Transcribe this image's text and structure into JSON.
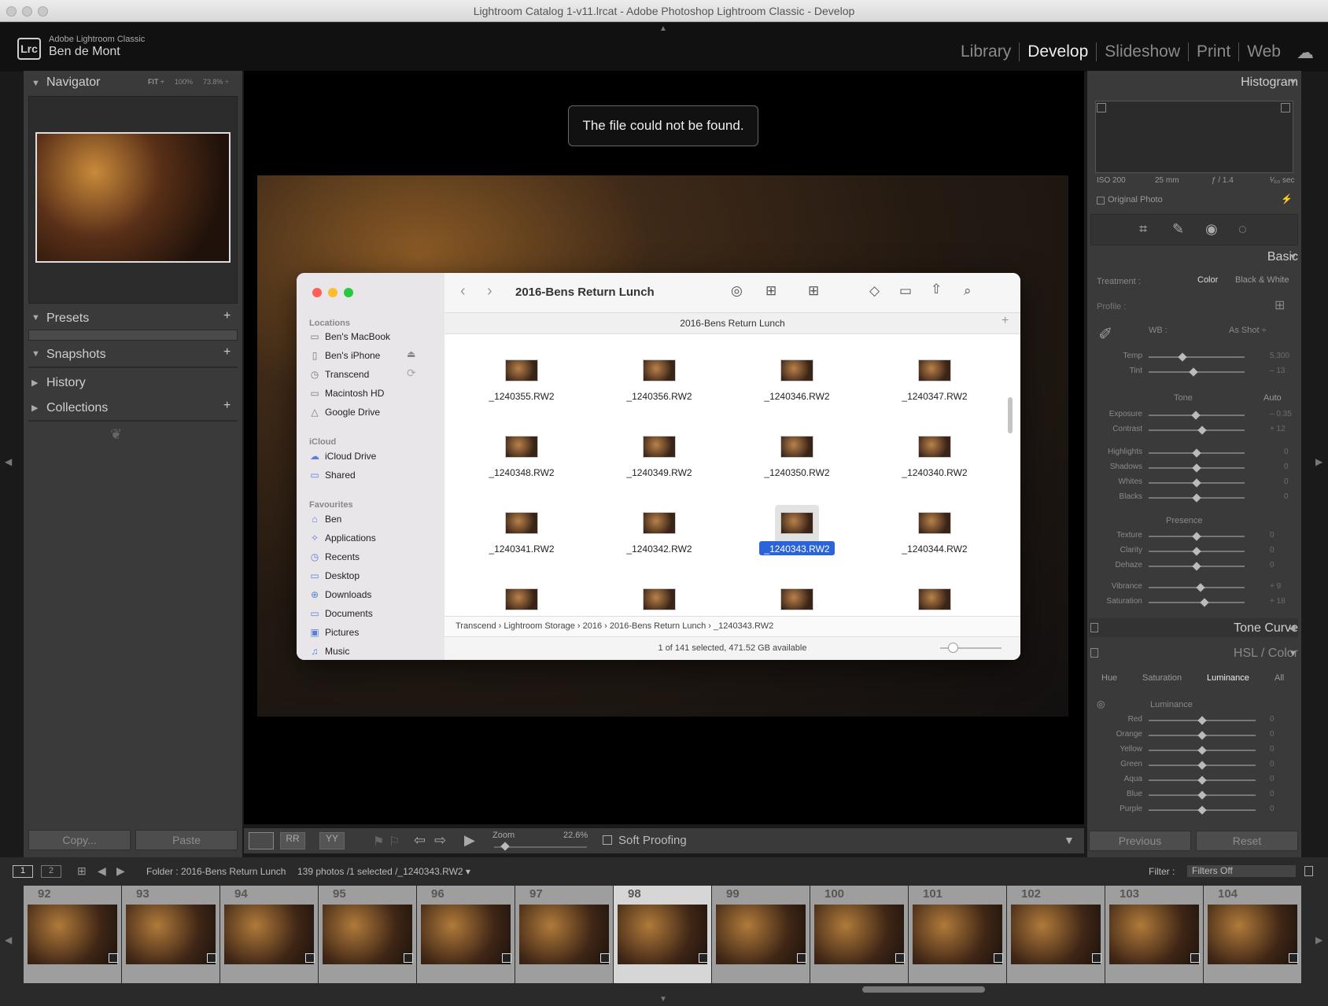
{
  "window": {
    "title": "Lightroom Catalog 1-v11.lrcat - Adobe Photoshop Lightroom Classic - Develop"
  },
  "identity": {
    "product": "Adobe Lightroom Classic",
    "user": "Ben de Mont",
    "logo": "Lrc"
  },
  "modules": [
    "Library",
    "Develop",
    "Slideshow",
    "Print",
    "Web"
  ],
  "navigator": {
    "title": "Navigator",
    "fit": "FIT ÷",
    "z100": "100%",
    "z738": "73.8% ÷"
  },
  "left_panels": {
    "presets": "Presets",
    "snapshots": "Snapshots",
    "history": "History",
    "collections": "Collections"
  },
  "left_buttons": {
    "copy": "Copy...",
    "paste": "Paste"
  },
  "toast": "The file could not be found.",
  "finder": {
    "title": "2016-Bens Return Lunch",
    "path_title": "2016-Bens Return Lunch",
    "sidebar": {
      "locations_label": "Locations",
      "locations": [
        "Ben's MacBook",
        "Ben's iPhone",
        "Transcend",
        "Macintosh HD",
        "Google Drive"
      ],
      "icloud_label": "iCloud",
      "icloud": [
        "iCloud Drive",
        "Shared"
      ],
      "favourites_label": "Favourites",
      "favourites": [
        "Ben",
        "Applications",
        "Recents",
        "Desktop",
        "Downloads",
        "Documents",
        "Pictures",
        "Music"
      ]
    },
    "files": [
      "_1240355.RW2",
      "_1240356.RW2",
      "_1240346.RW2",
      "_1240347.RW2",
      "_1240348.RW2",
      "_1240349.RW2",
      "_1240350.RW2",
      "_1240340.RW2",
      "_1240341.RW2",
      "_1240342.RW2",
      "_1240343.RW2",
      "_1240344.RW2"
    ],
    "selected_file": "_1240343.RW2",
    "breadcrumb": [
      "Transcend",
      "Lightroom Storage",
      "2016",
      "2016-Bens Return Lunch",
      "_1240343.RW2"
    ],
    "status": "1 of 141 selected, 471.52 GB available"
  },
  "center_toolbar": {
    "zoom_label": "Zoom",
    "zoom_value": "22.6%",
    "soft_proofing": "Soft Proofing"
  },
  "right": {
    "histogram": "Histogram",
    "exif": [
      "ISO 200",
      "25 mm",
      "ƒ / 1.4",
      "¹⁄₆₀ sec"
    ],
    "original_photo": "Original Photo",
    "basic": "Basic",
    "treatment_label": "Treatment :",
    "color": "Color",
    "bw": "Black & White",
    "profile_label": "Profile :",
    "wb_label": "WB :",
    "wb_value": "As Shot ÷",
    "wb_sliders": [
      {
        "label": "Temp",
        "value": "5,300",
        "pos": 0.35
      },
      {
        "label": "Tint",
        "value": "– 13",
        "pos": 0.47
      }
    ],
    "tone_label": "Tone",
    "auto": "Auto",
    "tone_sliders": [
      {
        "label": "Exposure",
        "value": "– 0.35",
        "pos": 0.49
      },
      {
        "label": "Contrast",
        "value": "+ 12",
        "pos": 0.56
      },
      {
        "label": "Highlights",
        "value": "0",
        "pos": 0.5
      },
      {
        "label": "Shadows",
        "value": "0",
        "pos": 0.5
      },
      {
        "label": "Whites",
        "value": "0",
        "pos": 0.5
      },
      {
        "label": "Blacks",
        "value": "0",
        "pos": 0.5
      }
    ],
    "presence_label": "Presence",
    "presence_sliders": [
      {
        "label": "Texture",
        "value": "0",
        "pos": 0.5
      },
      {
        "label": "Clarity",
        "value": "0",
        "pos": 0.5
      },
      {
        "label": "Dehaze",
        "value": "0",
        "pos": 0.5
      },
      {
        "label": "Vibrance",
        "value": "+ 9",
        "pos": 0.54
      },
      {
        "label": "Saturation",
        "value": "+ 18",
        "pos": 0.58
      }
    ],
    "tone_curve": "Tone Curve",
    "hsl": "HSL / Color",
    "hsl_tabs": [
      "Hue",
      "Saturation",
      "Luminance",
      "All"
    ],
    "luminance_label": "Luminance",
    "lum_sliders": [
      {
        "label": "Red",
        "value": "0"
      },
      {
        "label": "Orange",
        "value": "0"
      },
      {
        "label": "Yellow",
        "value": "0"
      },
      {
        "label": "Green",
        "value": "0"
      },
      {
        "label": "Aqua",
        "value": "0"
      },
      {
        "label": "Blue",
        "value": "0"
      },
      {
        "label": "Purple",
        "value": "0"
      }
    ],
    "previous": "Previous",
    "reset": "Reset"
  },
  "filmbar": {
    "page1": "1",
    "page2": "2",
    "folder": "Folder : 2016-Bens Return Lunch",
    "count": "139 photos /1 selected /_1240343.RW2 ▾",
    "filter_label": "Filter :",
    "filter_value": "Filters Off"
  },
  "filmstrip": {
    "numbers": [
      "92",
      "93",
      "94",
      "95",
      "96",
      "97",
      "98",
      "99",
      "100",
      "101",
      "102",
      "103",
      "104"
    ],
    "selected": "98"
  }
}
